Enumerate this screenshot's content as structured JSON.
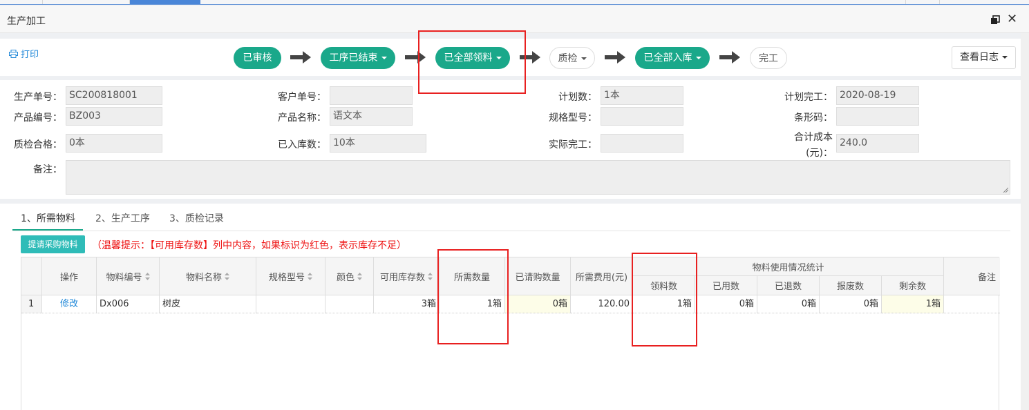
{
  "window": {
    "title": "生产加工"
  },
  "toolbar": {
    "print_label": "打印",
    "log_label": "查看日志"
  },
  "steps": [
    {
      "label": "已审核",
      "state": "done",
      "dropdown": false
    },
    {
      "label": "工序已结束",
      "state": "done",
      "dropdown": true
    },
    {
      "label": "已全部领料",
      "state": "done",
      "dropdown": true
    },
    {
      "label": "质检",
      "state": "pending",
      "dropdown": true
    },
    {
      "label": "已全部入库",
      "state": "done",
      "dropdown": true
    },
    {
      "label": "完工",
      "state": "pending",
      "dropdown": false
    }
  ],
  "form": {
    "production_no": {
      "label": "生产单号：",
      "value": "SC200818001"
    },
    "customer_no": {
      "label": "客户单号：",
      "value": ""
    },
    "planned_qty": {
      "label": "计划数：",
      "value": "1本"
    },
    "planned_finish": {
      "label": "计划完工：",
      "value": "2020-08-19"
    },
    "product_code": {
      "label": "产品编号：",
      "value": "BZ003"
    },
    "product_name": {
      "label": "产品名称：",
      "value": "语文本"
    },
    "spec_model": {
      "label": "规格型号：",
      "value": ""
    },
    "barcode": {
      "label": "条形码：",
      "value": ""
    },
    "qc_passed": {
      "label": "质检合格：",
      "value": "0本"
    },
    "stocked_qty": {
      "label": "已入库数：",
      "value": "10本"
    },
    "actual_finish": {
      "label": "实际完工：",
      "value": ""
    },
    "total_cost_line1": "合计成本",
    "total_cost_line2": "(元)：",
    "total_cost_value": "240.0",
    "remark_label": "备注："
  },
  "tabs": [
    "1、所需物料",
    "2、生产工序",
    "3、质检记录"
  ],
  "request_button": "提请采购物料",
  "tip": "（温馨提示：【可用库存数】列中内容，如果标识为红色，表示库存不足）",
  "table": {
    "headers": {
      "op": "操作",
      "code": "物料编号",
      "name": "物料名称",
      "spec": "规格型号",
      "color": "颜色",
      "stock": "可用库存数",
      "need": "所需数量",
      "requested": "已请购数量",
      "cost": "所需费用(元)",
      "group": "物料使用情况统计",
      "taken": "领料数",
      "used": "已用数",
      "returned": "已退数",
      "scrapped": "报废数",
      "remaining": "剩余数",
      "remark": "备注"
    },
    "rows": [
      {
        "idx": "1",
        "op": "修改",
        "code": "Dx006",
        "name": "树皮",
        "spec": "",
        "color": "",
        "stock": "3箱",
        "need": "1箱",
        "requested": "0箱",
        "cost": "120.00",
        "taken": "1箱",
        "used": "0箱",
        "returned": "0箱",
        "scrapped": "0箱",
        "remaining": "1箱",
        "remark": ""
      }
    ]
  },
  "colors": {
    "accent": "#1aa88a",
    "highlight": "#e82020",
    "link": "#1e87d8"
  }
}
